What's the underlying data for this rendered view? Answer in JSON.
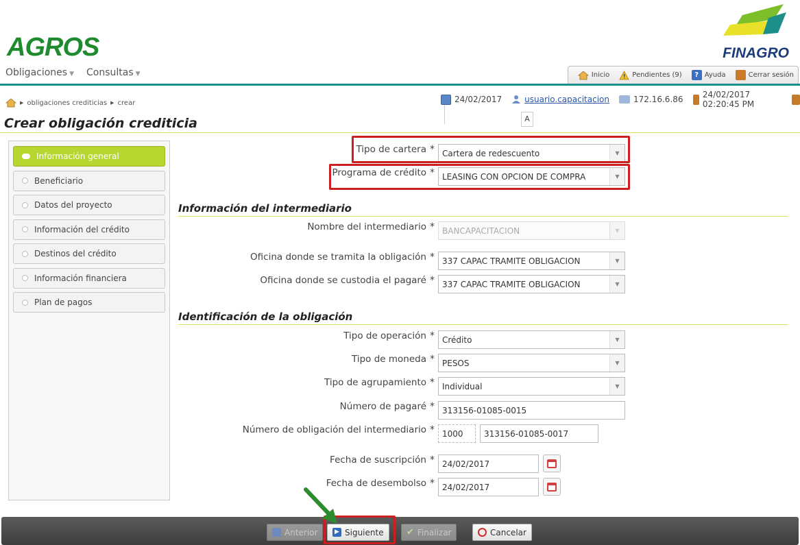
{
  "header": {
    "app_logo": "AGROS",
    "brand_logo": "FINAGRO",
    "nav": [
      "Obligaciones",
      "Consultas"
    ],
    "tabs": [
      "Inicio",
      "Pendientes (9)",
      "Ayuda",
      "Cerrar sesión"
    ]
  },
  "infobar": {
    "date": "24/02/2017",
    "user": "usuario.capacitacion",
    "ip": "172.16.6.86",
    "datetime": "24/02/2017 02:20:45 PM",
    "font_toggle": "A"
  },
  "breadcrumb": [
    "obligaciones crediticias",
    "crear"
  ],
  "page_title": "Crear obligación crediticia",
  "sidebar": [
    "Información general",
    "Beneficiario",
    "Datos del proyecto",
    "Información del crédito",
    "Destinos del crédito",
    "Información financiera",
    "Plan de pagos"
  ],
  "form": {
    "tipo_cartera": {
      "label": "Tipo de cartera",
      "value": "Cartera de redescuento"
    },
    "programa_credito": {
      "label": "Programa de crédito",
      "value": "LEASING CON OPCION DE COMPRA"
    },
    "section_intermediario": "Información del intermediario",
    "nombre_intermediario": {
      "label": "Nombre del intermediario",
      "value": "BANCAPACITACION"
    },
    "oficina_tramita": {
      "label": "Oficina donde se tramita la obligación",
      "value": "337 CAPAC TRAMITE OBLIGACION"
    },
    "oficina_custodia": {
      "label": "Oficina donde se custodia el pagaré",
      "value": "337 CAPAC TRAMITE OBLIGACION"
    },
    "section_identificacion": "Identificación de la obligación",
    "tipo_operacion": {
      "label": "Tipo de operación",
      "value": "Crédito"
    },
    "tipo_moneda": {
      "label": "Tipo de moneda",
      "value": "PESOS"
    },
    "tipo_agrupamiento": {
      "label": "Tipo de agrupamiento",
      "value": "Individual"
    },
    "numero_pagare": {
      "label": "Número de pagaré",
      "value": "313156-01085-0015"
    },
    "numero_obligacion": {
      "label": "Número de obligación del intermediario",
      "prefix": "1000",
      "value": "313156-01085-0017"
    },
    "fecha_suscripcion": {
      "label": "Fecha de suscripción",
      "value": "24/02/2017"
    },
    "fecha_desembolso": {
      "label": "Fecha de desembolso",
      "value": "24/02/2017"
    },
    "required_mark": "*"
  },
  "buttons": {
    "anterior": "Anterior",
    "siguiente": "Siguiente",
    "finalizar": "Finalizar",
    "cancelar": "Cancelar"
  },
  "colors": {
    "accent": "#b8d630",
    "highlight": "#cc1f1f",
    "brand_green": "#1f8a2e",
    "teal_line": "#1d8f8a"
  }
}
